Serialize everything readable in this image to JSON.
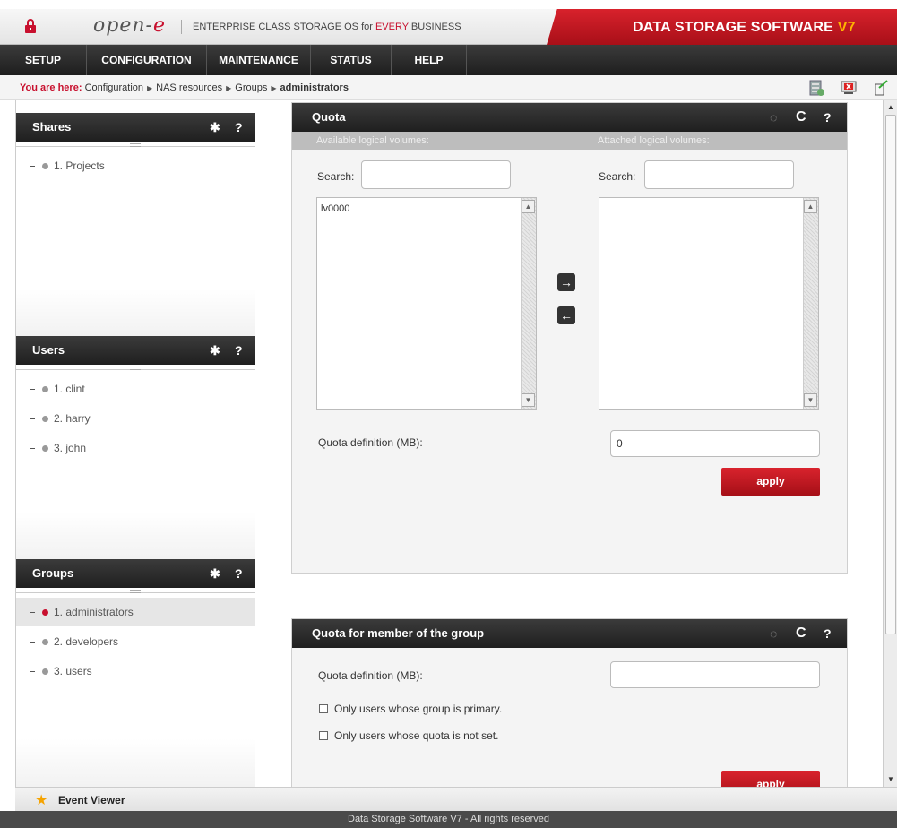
{
  "header": {
    "brand_prefix": "open-",
    "brand_suffix": "e",
    "tagline_pre": "ENTERPRISE CLASS STORAGE OS for ",
    "tagline_every": "EVERY",
    "tagline_post": " BUSINESS",
    "product": "DATA STORAGE SOFTWARE ",
    "product_version": "V7",
    "accent": "#c8102e"
  },
  "menu": {
    "items": [
      {
        "label": "SETUP"
      },
      {
        "label": "CONFIGURATION"
      },
      {
        "label": "MAINTENANCE"
      },
      {
        "label": "STATUS"
      },
      {
        "label": "HELP"
      }
    ]
  },
  "breadcrumb": {
    "here": "You are here:",
    "items": [
      "Configuration",
      "NAS resources",
      "Groups",
      "administrators"
    ]
  },
  "sidebar": {
    "shares": {
      "title": "Shares",
      "items": [
        "1. Projects"
      ]
    },
    "users": {
      "title": "Users",
      "items": [
        "1. clint",
        "2. harry",
        "3. john"
      ]
    },
    "groups": {
      "title": "Groups",
      "items": [
        "1. administrators",
        "2. developers",
        "3. users"
      ]
    }
  },
  "quota": {
    "title": "Quota",
    "available_label": "Available logical volumes:",
    "attached_label": "Attached logical volumes:",
    "search_label": "Search:",
    "available_items": [
      "lv0000"
    ],
    "quota_label": "Quota definition (MB):",
    "quota_value": "0",
    "apply_label": "apply"
  },
  "member_quota": {
    "title": "Quota for member of the group",
    "quota_label": "Quota definition (MB):",
    "quota_value": "",
    "check1_label": "Only users whose group is primary.",
    "check2_label": "Only users whose quota is not set.",
    "apply_label": "apply"
  },
  "footer": {
    "event_viewer": "Event Viewer",
    "copyright": "Data Storage Software V7 - All rights reserved"
  }
}
